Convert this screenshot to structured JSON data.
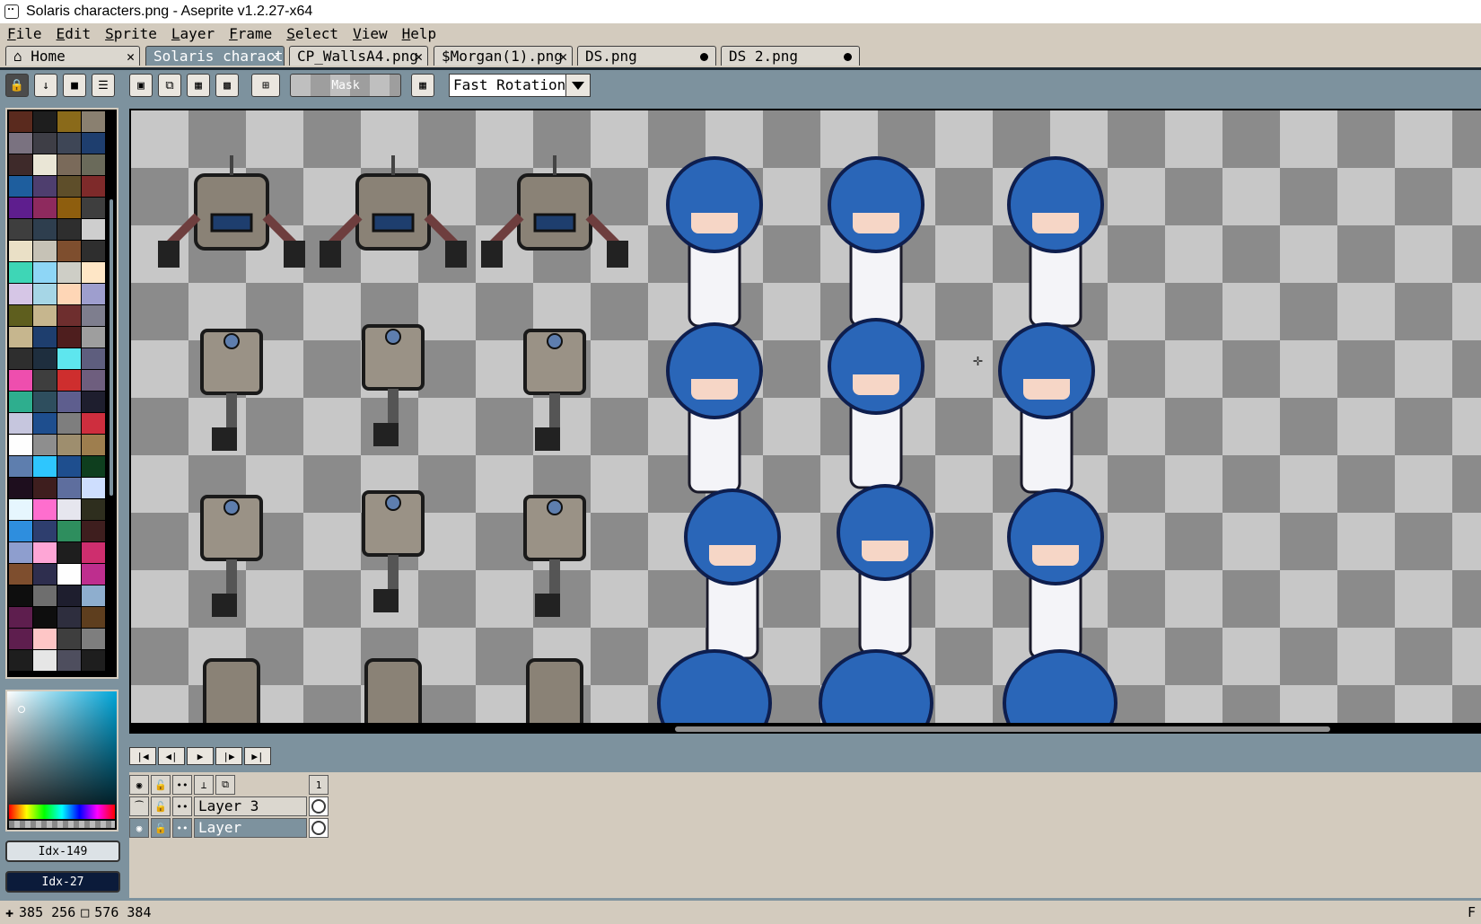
{
  "window": {
    "title": "Solaris characters.png - Aseprite v1.2.27-x64"
  },
  "menu": [
    "File",
    "Edit",
    "Sprite",
    "Layer",
    "Frame",
    "Select",
    "View",
    "Help"
  ],
  "tabs": [
    {
      "label": "Home",
      "icon": "home-icon",
      "indicator": "close"
    },
    {
      "label": "Solaris charact",
      "active": true,
      "indicator": "close"
    },
    {
      "label": "CP_WallsA4.png",
      "indicator": "close"
    },
    {
      "label": "$Morgan(1).png",
      "indicator": "close"
    },
    {
      "label": "DS.png",
      "indicator": "modified-dot"
    },
    {
      "label": "DS 2.png",
      "indicator": "modified-dot"
    }
  ],
  "toolbar": {
    "mask_label": "Mask",
    "rotation_algorithm": "Fast Rotation",
    "icons": [
      "lock-icon",
      "arrow-down-icon",
      "square-icon",
      "menu-icon",
      "select-replace-icon",
      "select-add-icon",
      "select-subtract-icon",
      "select-intersect-icon",
      "pivot-icon",
      "grid-icon"
    ]
  },
  "palette": {
    "colors": [
      "#5a2a1e",
      "#1e1e1e",
      "#8a6a1a",
      "#8a8070",
      "#7a7280",
      "#3e3e46",
      "#3e4656",
      "#1e3e6e",
      "#3e2a2a",
      "#eae6d6",
      "#7a6a5a",
      "#6a6a5a",
      "#1e5e9e",
      "#4e3e6e",
      "#5e4e2a",
      "#7e2a2a",
      "#5e1e8e",
      "#8e2a5e",
      "#8e5e0e",
      "#3e3e3e",
      "#3e3e3e",
      "#2e3e4e",
      "#2e2e2e",
      "#cecece",
      "#eae0c6",
      "#c6c2b6",
      "#7e4e2e",
      "#2e2e2e",
      "#3ed6b6",
      "#8ed6f6",
      "#cecec6",
      "#fee6c6",
      "#d6c6e6",
      "#a6d6e6",
      "#fed6b6",
      "#9e9ece",
      "#5e5e1e",
      "#c6b68e",
      "#6e2e2e",
      "#7e7e8e",
      "#c6b68e",
      "#1e3e6e",
      "#4e1e1e",
      "#9e9e9e",
      "#2e2e2e",
      "#1e2e3e",
      "#5ee6ee",
      "#5e5e7e",
      "#ee4eae",
      "#3e3e3e",
      "#ce2e2e",
      "#6e5e7e",
      "#2eae8e",
      "#2e4e5e",
      "#5e5e8e",
      "#1e1e2e",
      "#c6c6de",
      "#1e4e8e",
      "#7e7e7e",
      "#ce2e3e",
      "#fefefe",
      "#8e8e8e",
      "#9e8e6e",
      "#9e7e4e",
      "#5e7eae",
      "#2ec6fe",
      "#1e4e8e",
      "#0e3e1e",
      "#1e0e1e",
      "#3e1e1e",
      "#5e6e9e",
      "#cedefe",
      "#e6f6fe",
      "#fe6ece",
      "#e6e6ee",
      "#2e2e1e",
      "#2e8ede",
      "#2e3e6e",
      "#2e8e5e",
      "#3e1e1e",
      "#8e9ece",
      "#fea6d6",
      "#1e1e1e",
      "#ce2e6e",
      "#7e4e2e",
      "#2e2e4e",
      "#fefefe",
      "#be2e8e",
      "#0e0e0e",
      "#6e6e6e",
      "#1e1e2e",
      "#8eaece",
      "#5e1e4e",
      "#0e0e0e",
      "#2e2e3e",
      "#5e3e1e",
      "#5e1e4e",
      "#fec6c6",
      "#3e3e3e",
      "#7e7e7e",
      "#1e1e1e",
      "#e6e6e6",
      "#4e4e5e",
      "#1e1e1e"
    ]
  },
  "color_buttons": {
    "foreground": "Idx-149",
    "background": "Idx-27"
  },
  "timeline": {
    "frame_number": "1",
    "controls": [
      "first-frame-icon",
      "prev-frame-icon",
      "play-icon",
      "next-frame-icon",
      "last-frame-icon"
    ],
    "layers": [
      {
        "name": "Layer 3",
        "visible": false
      },
      {
        "name": "Layer",
        "visible": true,
        "selected": true
      }
    ]
  },
  "status": {
    "cursor_pos": "385 256",
    "selection_size": "576 384",
    "right_text": "F"
  }
}
